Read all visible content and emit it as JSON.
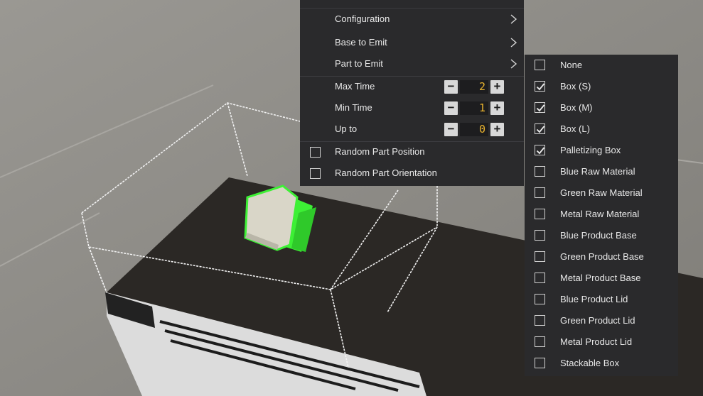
{
  "menu": {
    "configuration": "Configuration",
    "base_to_emit": "Base to Emit",
    "part_to_emit": "Part to Emit",
    "max_time": {
      "label": "Max Time",
      "value": "2"
    },
    "min_time": {
      "label": "Min Time",
      "value": "1"
    },
    "up_to": {
      "label": "Up to",
      "value": "0"
    },
    "random_part_position": {
      "label": "Random Part Position",
      "checked": false
    },
    "random_part_orientation": {
      "label": "Random Part Orientation",
      "checked": false
    },
    "minus_glyph": "−",
    "plus_glyph": "+"
  },
  "part_options": [
    {
      "label": "None",
      "checked": false
    },
    {
      "label": "Box (S)",
      "checked": true
    },
    {
      "label": "Box (M)",
      "checked": true
    },
    {
      "label": "Box (L)",
      "checked": true
    },
    {
      "label": "Palletizing Box",
      "checked": true
    },
    {
      "label": "Blue Raw Material",
      "checked": false
    },
    {
      "label": "Green Raw Material",
      "checked": false
    },
    {
      "label": "Metal Raw Material",
      "checked": false
    },
    {
      "label": "Blue Product Base",
      "checked": false
    },
    {
      "label": "Green Product Base",
      "checked": false
    },
    {
      "label": "Metal Product Base",
      "checked": false
    },
    {
      "label": "Blue Product Lid",
      "checked": false
    },
    {
      "label": "Green Product Lid",
      "checked": false
    },
    {
      "label": "Metal Product Lid",
      "checked": false
    },
    {
      "label": "Stackable Box",
      "checked": false
    }
  ],
  "colors": {
    "panel_bg": "#2a2a2c",
    "value_text": "#e9b32e",
    "selection_green": "#3df035",
    "conveyor_belt": "#2b2825",
    "floor": "#8f8d88"
  },
  "icons": {
    "submenu": "chevron-right-icon",
    "check": "checkmark-icon"
  }
}
